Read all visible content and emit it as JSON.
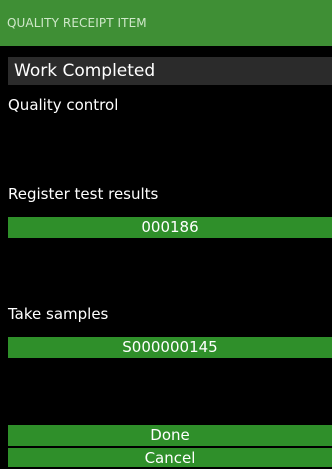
{
  "header": {
    "title": "QUALITY RECEIPT ITEM"
  },
  "status": {
    "text": "Work Completed"
  },
  "sections": {
    "quality_control": "Quality control",
    "register_label": "Register test results",
    "register_value": "000186",
    "samples_label": "Take samples",
    "samples_value": "S000000145"
  },
  "actions": {
    "done": "Done",
    "cancel": "Cancel"
  },
  "colors": {
    "header_bg": "#3f8f35",
    "button_bg": "#2f8f2a",
    "status_bg": "#2b2b2b",
    "page_bg": "#000000"
  }
}
